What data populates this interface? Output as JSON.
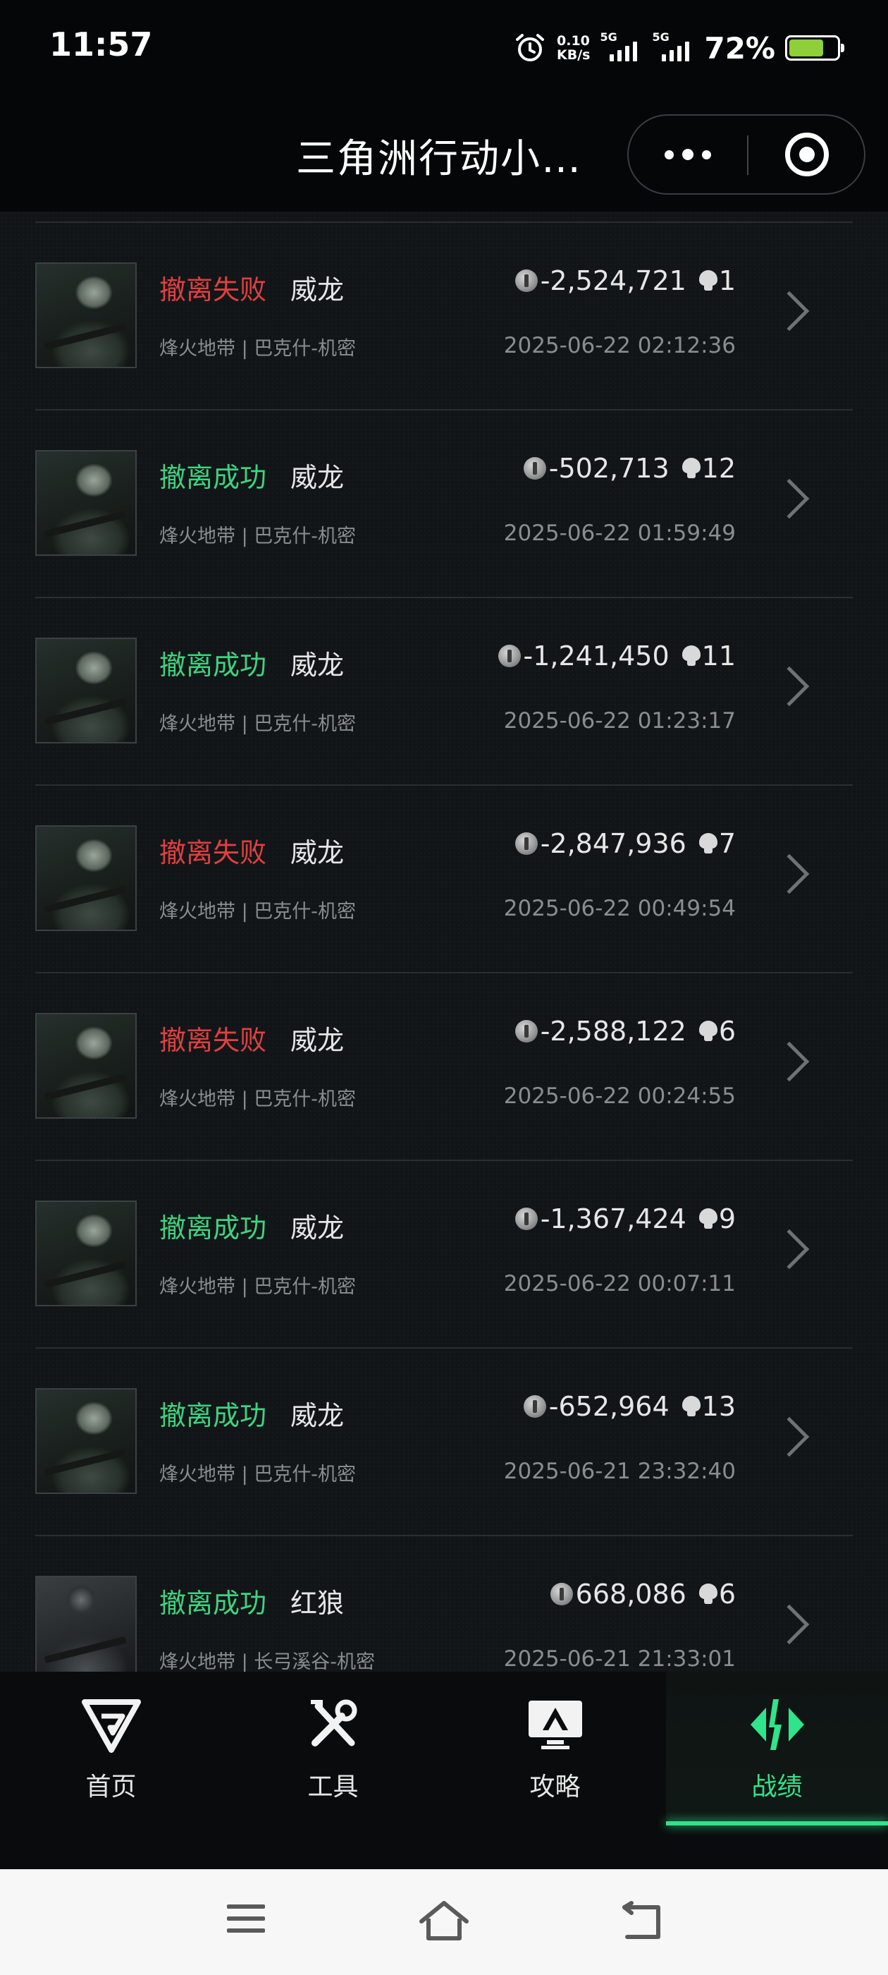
{
  "status_bar": {
    "time": "11:57",
    "net_speed_value": "0.10",
    "net_speed_unit": "KB/s",
    "sim1_label": "5G",
    "sim2_label": "5G",
    "battery_percent": "72%",
    "battery_level": 0.72,
    "icons": [
      "alarm-icon",
      "signal-icon",
      "signal-icon",
      "battery-icon"
    ]
  },
  "header": {
    "title": "三角洲行动小…",
    "more_icon": "more-dots-icon",
    "close_icon": "target-close-icon"
  },
  "records": [
    {
      "status": "撤离失败",
      "result": "fail",
      "operator": "威龙",
      "value": "-2,524,721",
      "kills": "1",
      "mode": "烽火地带 | 巴克什-机密",
      "time": "2025-06-22 02:12:36"
    },
    {
      "status": "撤离成功",
      "result": "ok",
      "operator": "威龙",
      "value": "-502,713",
      "kills": "12",
      "mode": "烽火地带 | 巴克什-机密",
      "time": "2025-06-22 01:59:49"
    },
    {
      "status": "撤离成功",
      "result": "ok",
      "operator": "威龙",
      "value": "-1,241,450",
      "kills": "11",
      "mode": "烽火地带 | 巴克什-机密",
      "time": "2025-06-22 01:23:17"
    },
    {
      "status": "撤离失败",
      "result": "fail",
      "operator": "威龙",
      "value": "-2,847,936",
      "kills": "7",
      "mode": "烽火地带 | 巴克什-机密",
      "time": "2025-06-22 00:49:54"
    },
    {
      "status": "撤离失败",
      "result": "fail",
      "operator": "威龙",
      "value": "-2,588,122",
      "kills": "6",
      "mode": "烽火地带 | 巴克什-机密",
      "time": "2025-06-22 00:24:55"
    },
    {
      "status": "撤离成功",
      "result": "ok",
      "operator": "威龙",
      "value": "-1,367,424",
      "kills": "9",
      "mode": "烽火地带 | 巴克什-机密",
      "time": "2025-06-22 00:07:11"
    },
    {
      "status": "撤离成功",
      "result": "ok",
      "operator": "威龙",
      "value": "-652,964",
      "kills": "13",
      "mode": "烽火地带 | 巴克什-机密",
      "time": "2025-06-21 23:32:40"
    },
    {
      "status": "撤离成功",
      "result": "ok",
      "operator": "红狼",
      "value": "668,086",
      "kills": "6",
      "mode": "烽火地带 | 长弓溪谷-机密",
      "time": "2025-06-21 21:33:01"
    }
  ],
  "bottom_nav": {
    "items": [
      {
        "label": "首页",
        "icon": "home-logo-icon"
      },
      {
        "label": "工具",
        "icon": "tools-icon"
      },
      {
        "label": "攻略",
        "icon": "guide-monitor-icon"
      },
      {
        "label": "战绩",
        "icon": "records-icon",
        "active": true
      }
    ]
  },
  "colors": {
    "fail": "#e0403f",
    "success": "#3fd37f",
    "accent": "#2fe48a"
  }
}
